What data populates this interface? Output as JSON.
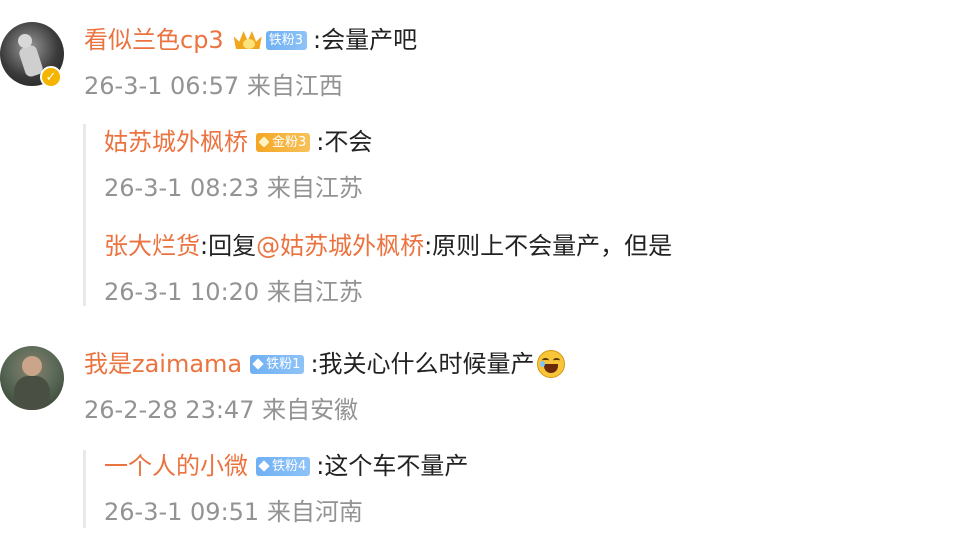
{
  "comments": [
    {
      "user": "看似兰色cp3",
      "fan_badge": "铁粉3",
      "text": ":会量产吧",
      "time": "26-3-1 06:57 来自江西",
      "replies": [
        {
          "user": "姑苏城外枫桥",
          "fan_badge": "金粉3",
          "text": ":不会",
          "time": "26-3-1 08:23 来自江苏"
        },
        {
          "user": "张大烂货",
          "reply_prefix": ":回复",
          "mention": "@姑苏城外枫桥",
          "text": ":原则上不会量产，但是",
          "time": "26-3-1 10:20 来自江苏"
        }
      ]
    },
    {
      "user": "我是zaimama",
      "fan_badge": "铁粉1",
      "text": ":我关心什么时候量产",
      "time": "26-2-28 23:47 来自安徽",
      "replies": [
        {
          "user": "一个人的小微",
          "fan_badge": "铁粉4",
          "text": ":这个车不量产",
          "time": "26-3-1 09:51 来自河南"
        }
      ]
    }
  ],
  "colors": {
    "name": "#eb7340",
    "time": "#939393",
    "badge_blue": "#6fb0f3",
    "badge_gold": "#f5a623"
  }
}
